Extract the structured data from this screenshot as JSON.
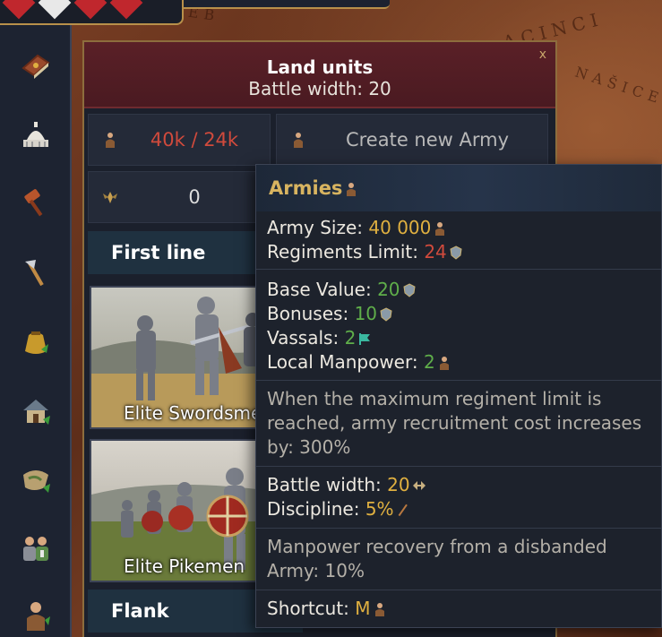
{
  "map": {
    "labels": [
      "ACINCI",
      "NAŠICE",
      "EB"
    ]
  },
  "panel": {
    "title": "Land units",
    "subtitle": "Battle width: 20",
    "close_label": "x",
    "manpower_value": "40k / 24k",
    "create_army_label": "Create new Army",
    "counter_value": "0",
    "first_line_label": "First line",
    "flank_label": "Flank",
    "units": [
      {
        "name": "Elite Swordsmen"
      },
      {
        "name": "Elite Pikemen"
      }
    ]
  },
  "tooltip": {
    "title": "Armies",
    "army_size_label": "Army Size:",
    "army_size_value": "40 000",
    "regiments_limit_label": "Regiments Limit:",
    "regiments_limit_value": "24",
    "base_value_label": "Base Value:",
    "base_value_value": "20",
    "bonuses_label": "Bonuses:",
    "bonuses_value": "10",
    "vassals_label": "Vassals:",
    "vassals_value": "2",
    "local_manpower_label": "Local Manpower:",
    "local_manpower_value": "2",
    "description_1": "When the maximum regiment limit is",
    "description_2": "reached, army recruitment cost increases",
    "description_3": "by: 300%",
    "battle_width_label": "Battle width:",
    "battle_width_value": "20",
    "discipline_label": "Discipline:",
    "discipline_value": "5%",
    "recovery_1": "Manpower recovery from a disbanded",
    "recovery_2": "Army: 10%",
    "shortcut_label": "Shortcut:",
    "shortcut_value": "M"
  },
  "colors": {
    "gold": "#e0b040",
    "red": "#d04a3c",
    "green": "#5fae4a",
    "header_red": "#5a2027"
  },
  "icons": {
    "sidebar": [
      "book-icon",
      "capitol-icon",
      "gavel-icon",
      "axe-icon",
      "money-bag-icon",
      "house-icon",
      "scroll-map-icon",
      "people-icon",
      "soldier-icon"
    ]
  }
}
